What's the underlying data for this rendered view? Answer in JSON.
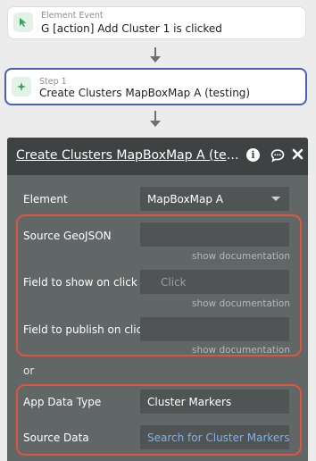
{
  "event": {
    "kind": "Element Event",
    "title": "G [action] Add Cluster 1 is clicked",
    "icon": "cursor-icon"
  },
  "step": {
    "kind": "Step 1",
    "title": "Create Clusters MapBoxMap A (testing)",
    "icon": "plugin-icon",
    "accent": "#4a5fb8"
  },
  "panel": {
    "title": "Create Clusters MapBoxMap A (testing)",
    "icons": [
      "info-icon",
      "comment-icon",
      "close-icon"
    ],
    "fields": {
      "element": {
        "label": "Element",
        "value": "MapBoxMap A"
      },
      "source_geojson": {
        "label": "Source GeoJSON",
        "value": "",
        "doc_link": "show documentation"
      },
      "field_show_on_click": {
        "label": "Field to show on click",
        "placeholder": "Click",
        "doc_link": "show documentation"
      },
      "field_publish_on_click": {
        "label": "Field to publish on clic",
        "value": "",
        "doc_link": "show documentation"
      },
      "app_data_type": {
        "label": "App Data Type",
        "value": "Cluster Markers"
      },
      "source_data": {
        "label": "Source Data",
        "value": "Search for Cluster Markerss"
      }
    },
    "or_label": "or",
    "highlight_color": "#e0553a"
  }
}
